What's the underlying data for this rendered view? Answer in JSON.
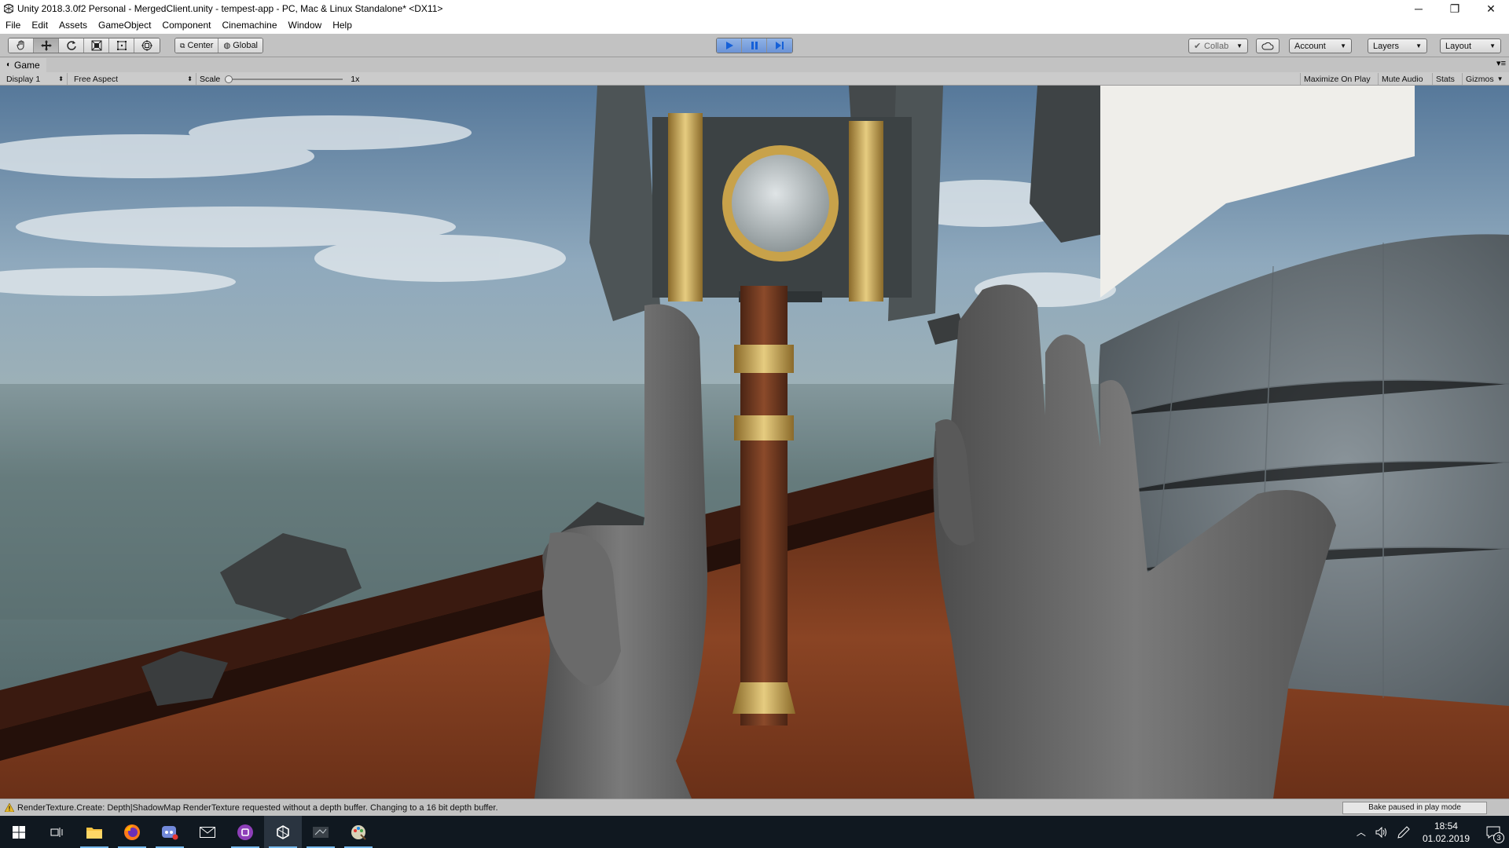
{
  "window": {
    "title": "Unity 2018.3.0f2 Personal - MergedClient.unity - tempest-app - PC, Mac & Linux Standalone* <DX11>",
    "minimize": "─",
    "restore": "❐",
    "close": "✕"
  },
  "menu": [
    "File",
    "Edit",
    "Assets",
    "GameObject",
    "Component",
    "Cinemachine",
    "Window",
    "Help"
  ],
  "toolbar": {
    "pivot_mode": "Center",
    "pivot_rotation": "Global",
    "collab": "Collab",
    "account": "Account",
    "layers": "Layers",
    "layout": "Layout",
    "play_state": "playing"
  },
  "game_view": {
    "tab_label": "Game",
    "display": "Display 1",
    "aspect": "Free Aspect",
    "scale_label": "Scale",
    "scale_value": "1x",
    "scale_slider_fraction": 0.0,
    "maximize_on_play": "Maximize On Play",
    "mute_audio": "Mute Audio",
    "stats": "Stats",
    "gizmos": "Gizmos"
  },
  "scene": {
    "description_colors": {
      "sky_top": "#4a6f93",
      "sky_mid": "#9fb8c9",
      "horizon": "#6b8385",
      "sea": "#4d6466",
      "deck": "#7a3a1e",
      "railing": "#3a1a12",
      "stone": "#5a5f61",
      "gold": "#c8a24a",
      "hands": "#6c6c6c",
      "dome": "#7d878d"
    }
  },
  "status": {
    "message": "RenderTexture.Create: Depth|ShadowMap RenderTexture requested without a depth buffer. Changing to a 16 bit depth buffer.",
    "bake": "Bake paused in play mode"
  },
  "taskbar": {
    "time": "18:54",
    "date": "01.02.2019",
    "notifications": "3"
  }
}
